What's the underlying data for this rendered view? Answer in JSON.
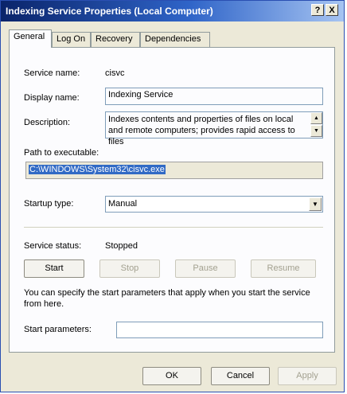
{
  "window": {
    "title": "Indexing Service Properties (Local Computer)",
    "help_label": "?",
    "close_label": "X"
  },
  "tabs": [
    {
      "label": "General",
      "active": true
    },
    {
      "label": "Log On",
      "active": false
    },
    {
      "label": "Recovery",
      "active": false
    },
    {
      "label": "Dependencies",
      "active": false
    }
  ],
  "general": {
    "service_name_label": "Service name:",
    "service_name_value": "cisvc",
    "display_name_label": "Display name:",
    "display_name_value": "Indexing Service",
    "description_label": "Description:",
    "description_value": "Indexes contents and properties of files on local and remote computers; provides rapid access to files",
    "path_label": "Path to executable:",
    "path_value": "C:\\WINDOWS\\System32\\cisvc.exe",
    "startup_type_label": "Startup type:",
    "startup_type_value": "Manual",
    "service_status_label": "Service status:",
    "service_status_value": "Stopped",
    "start_button": "Start",
    "stop_button": "Stop",
    "pause_button": "Pause",
    "resume_button": "Resume",
    "hint_text": "You can specify the start parameters that apply when you start the service from here.",
    "start_params_label": "Start parameters:",
    "start_params_value": ""
  },
  "footer": {
    "ok_button": "OK",
    "cancel_button": "Cancel",
    "apply_button": "Apply"
  },
  "icons": {
    "scroll_up": "scroll-up-arrow-icon",
    "scroll_down": "scroll-down-arrow-icon",
    "dropdown": "chevron-down-icon"
  }
}
